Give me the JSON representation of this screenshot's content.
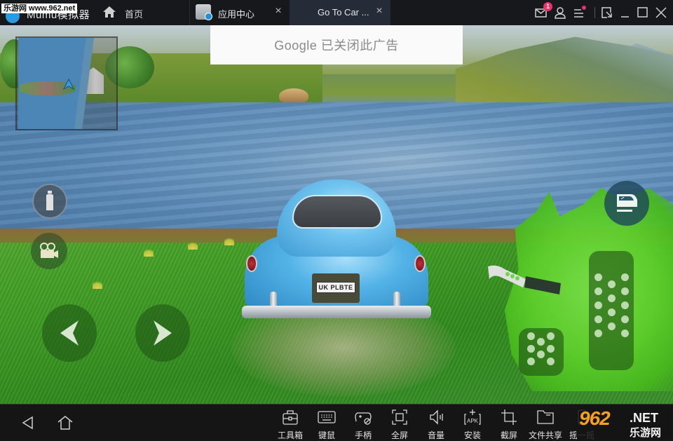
{
  "titlebar": {
    "app_name": "Mumu模拟器",
    "watermark": "乐游网 www.962.net",
    "home_tab": {
      "label": "首页",
      "icon": "home-icon"
    },
    "tabs": [
      {
        "label": "应用中心",
        "icon": "app-center-bag-icon",
        "active": false
      },
      {
        "label": "Go To Car ...",
        "icon": "game-thumbnail-icon",
        "active": true
      }
    ],
    "messages": {
      "icon": "mail-icon",
      "badge_count": "1"
    },
    "user_icon": "user-icon",
    "menu_icon": "menu-icon",
    "window_controls": [
      "shrink-icon",
      "minimize-icon",
      "maximize-icon",
      "close-icon"
    ]
  },
  "ad_banner": {
    "text": "Google 已关闭此广告"
  },
  "game": {
    "license_plate": "UK PLBTE",
    "controls": [
      {
        "name": "nitro",
        "icon": "nitro-bottle-icon"
      },
      {
        "name": "camera",
        "icon": "camera-icon"
      },
      {
        "name": "steer-left",
        "icon": "arrow-left-icon"
      },
      {
        "name": "steer-right",
        "icon": "arrow-right-icon"
      },
      {
        "name": "door",
        "icon": "car-door-icon"
      },
      {
        "name": "handbrake",
        "icon": "handbrake-icon"
      },
      {
        "name": "brake-pedal",
        "icon": "brake-pedal-icon"
      },
      {
        "name": "gas-pedal",
        "icon": "gas-pedal-icon"
      }
    ]
  },
  "bottombar": {
    "nav": [
      {
        "name": "back",
        "icon": "back-triangle-icon"
      },
      {
        "name": "home",
        "icon": "android-home-icon"
      }
    ],
    "tools": [
      {
        "label": "工具箱",
        "icon": "toolbox-icon"
      },
      {
        "label": "键鼠",
        "icon": "keyboard-icon"
      },
      {
        "label": "手柄",
        "icon": "gamepad-icon"
      },
      {
        "label": "全屏",
        "icon": "fullscreen-icon"
      },
      {
        "label": "音量",
        "icon": "volume-icon"
      },
      {
        "label": "安装",
        "icon": "apk-install-icon"
      },
      {
        "label": "截屏",
        "icon": "crop-screenshot-icon"
      },
      {
        "label": "文件共享",
        "icon": "folder-icon"
      },
      {
        "label": "摇一摇",
        "icon": "shake-icon"
      }
    ],
    "watermark": {
      "brand": "962",
      "suffix": ".NET",
      "cn": "乐游网"
    }
  }
}
